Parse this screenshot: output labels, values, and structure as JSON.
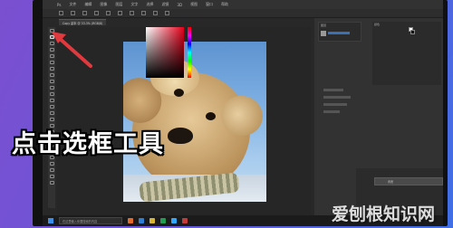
{
  "photoshop": {
    "menu": [
      "Ps",
      "文件",
      "编辑",
      "图像",
      "图层",
      "文字",
      "选择",
      "滤镜",
      "3D",
      "视图",
      "窗口",
      "帮助"
    ],
    "doc_tab": "Copy 副本 @ 33.3% (RGB/8)",
    "layers_title": "图层",
    "layer_name": "背景",
    "color_title": "颜色"
  },
  "taskbar": {
    "search_placeholder": "在这里输入你要搜索的内容"
  },
  "overlay": {
    "caption": "点击选框工具",
    "watermark": "爱刨根知识网"
  },
  "colors": {
    "arrow": "#e0393e",
    "background_start": "#7a4fd0",
    "background_end": "#3f6fe6"
  }
}
